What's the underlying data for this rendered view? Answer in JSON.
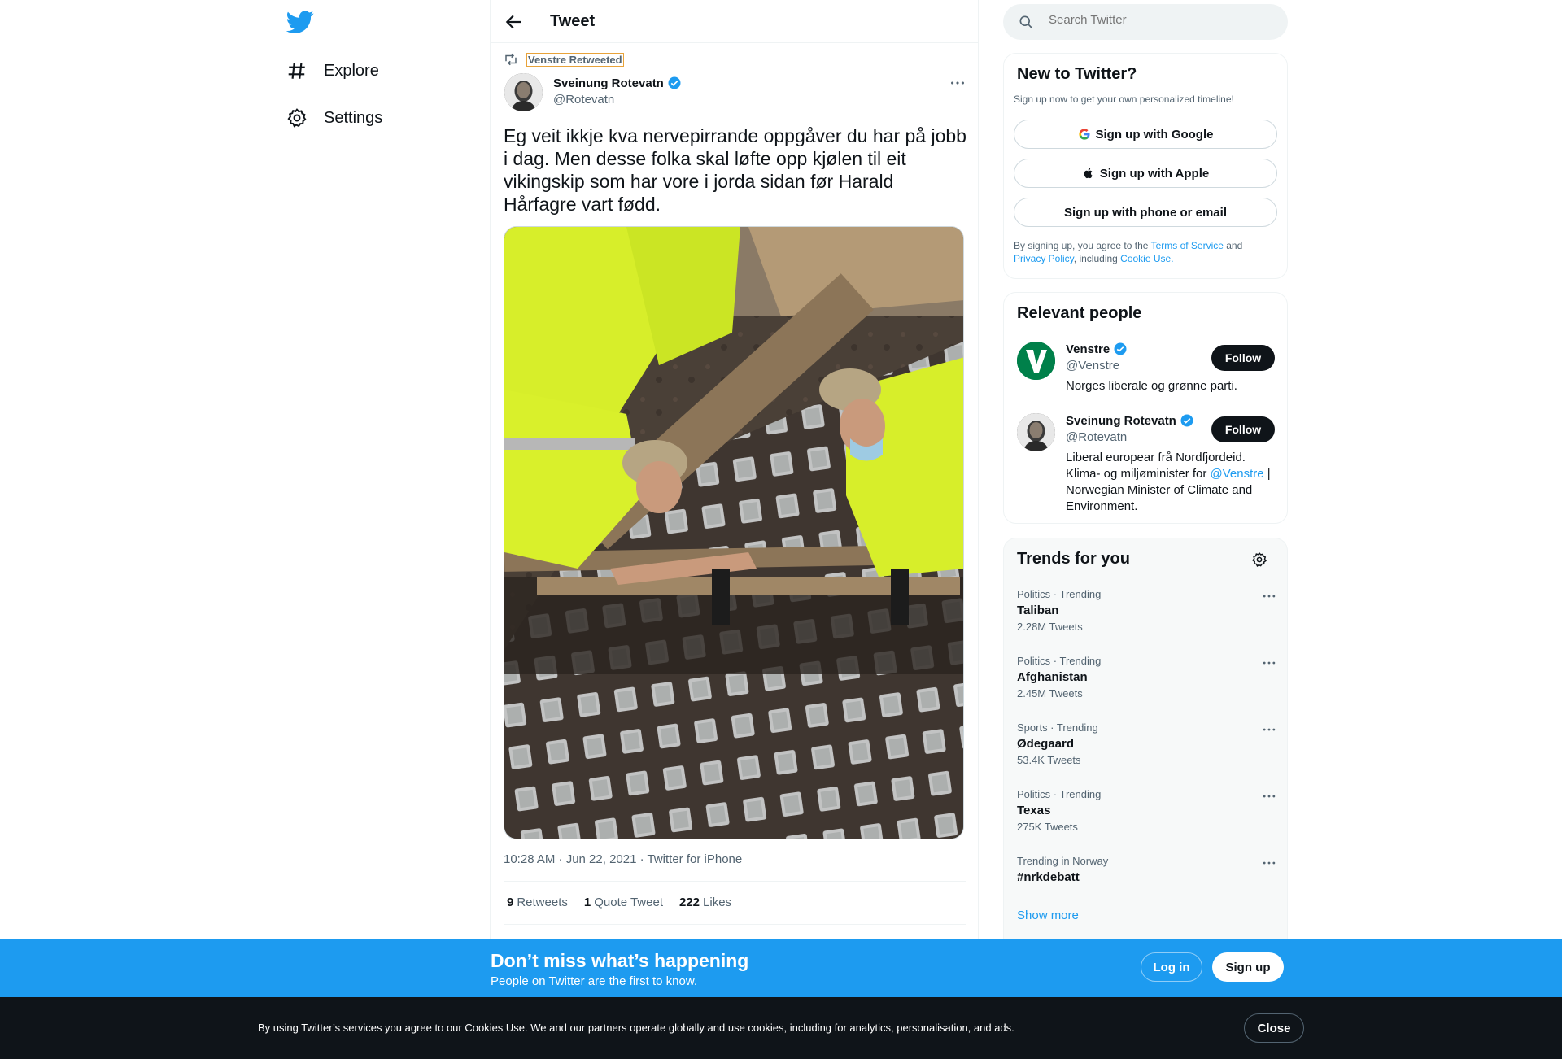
{
  "nav": {
    "items": [
      {
        "label": "Explore",
        "icon": "hashtag-icon"
      },
      {
        "label": "Settings",
        "icon": "gear-icon"
      }
    ]
  },
  "header": {
    "title": "Tweet"
  },
  "tweet": {
    "retweeted_by": "Venstre Retweeted",
    "author_name": "Sveinung Rotevatn",
    "author_handle": "@Rotevatn",
    "text": "Eg veit ikkje kva nervepirrande oppgåver du har på jobb i dag. Men desse folka skal løfte opp kjølen til eit vikingskip som har vore i jorda sidan før Harald Hårfagre vart fødd.",
    "meta": "10:28 AM · Jun 22, 2021 · Twitter for iPhone",
    "stats": [
      {
        "count": "9",
        "label": "Retweets"
      },
      {
        "count": "1",
        "label": "Quote Tweet"
      },
      {
        "count": "222",
        "label": "Likes"
      }
    ]
  },
  "search": {
    "placeholder": "Search Twitter"
  },
  "new_to_twitter": {
    "title": "New to Twitter?",
    "subtitle": "Sign up now to get your own personalized timeline!",
    "google": "Sign up with Google",
    "apple": "Sign up with Apple",
    "phone": "Sign up with phone or email",
    "terms_prefix": "By signing up, you agree to the ",
    "terms_link": "Terms of Service",
    "and": " and",
    "privacy_link": "Privacy Policy",
    "including": ", including ",
    "cookie_link": "Cookie Use."
  },
  "relevant": {
    "title": "Relevant people",
    "people": [
      {
        "name": "Venstre",
        "handle": "@Venstre",
        "bio": "Norges liberale og grønne parti.",
        "follow": "Follow"
      },
      {
        "name": "Sveinung Rotevatn",
        "handle": "@Rotevatn",
        "bio_pre": "Liberal europear frå Nordfjordeid. Klima- og miljøminister for ",
        "bio_link": "@Venstre",
        "bio_post": " | Norwegian Minister of Climate and Environment.",
        "follow": "Follow"
      }
    ]
  },
  "trends": {
    "title": "Trends for you",
    "items": [
      {
        "context": "Politics · Trending",
        "name": "Taliban",
        "count": "2.28M Tweets"
      },
      {
        "context": "Politics · Trending",
        "name": "Afghanistan",
        "count": "2.45M Tweets"
      },
      {
        "context": "Sports · Trending",
        "name": "Ødegaard",
        "count": "53.4K Tweets"
      },
      {
        "context": "Politics · Trending",
        "name": "Texas",
        "count": "275K Tweets"
      },
      {
        "context": "Trending in Norway",
        "name": "#nrkdebatt",
        "count": ""
      }
    ],
    "show_more": "Show more"
  },
  "signup_bar": {
    "heading": "Don’t miss what’s happening",
    "sub": "People on Twitter are the first to know.",
    "login": "Log in",
    "signup": "Sign up"
  },
  "cookie_bar": {
    "text": "By using Twitter’s services you agree to our Cookies Use. We and our partners operate globally and use cookies, including for analytics, personalisation, and ads.",
    "close": "Close"
  },
  "colors": {
    "accent": "#1d9bf0",
    "dark": "#0f1419",
    "muted": "#536471"
  }
}
